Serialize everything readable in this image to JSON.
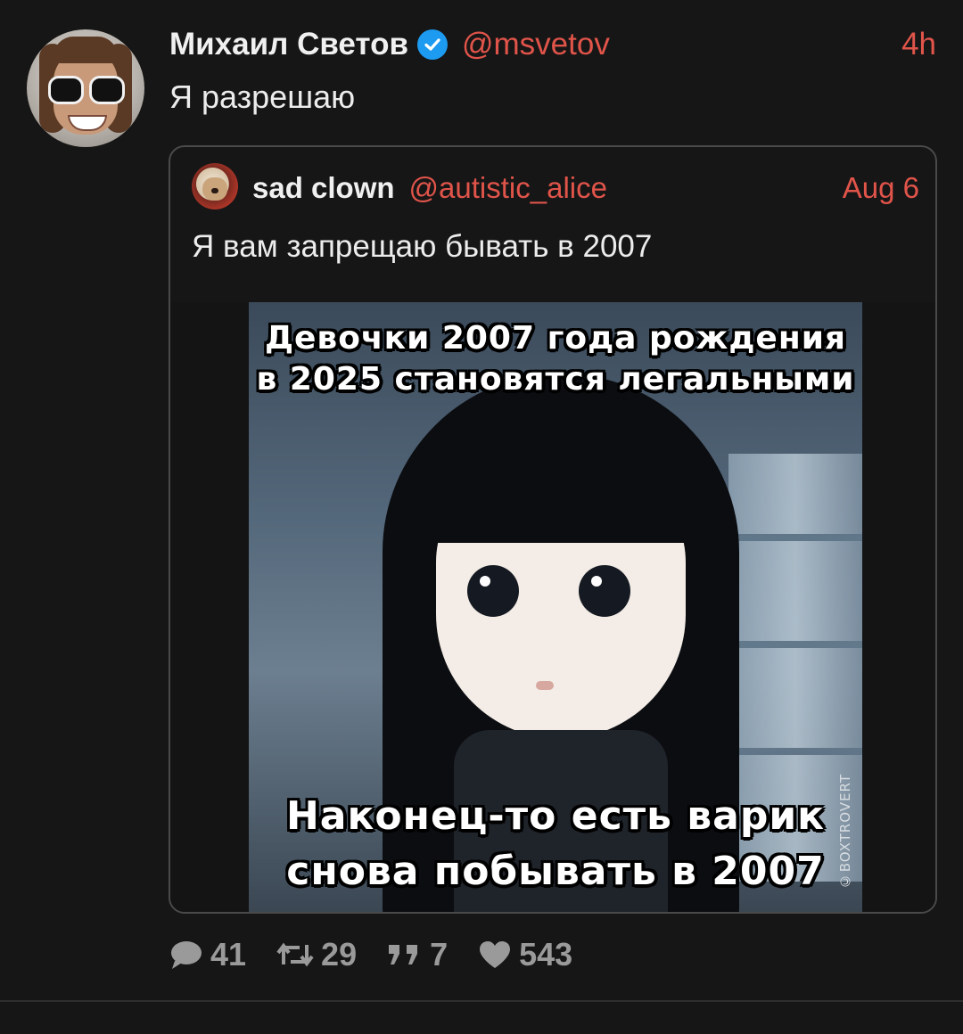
{
  "tweet": {
    "author_name": "Михаил Светов",
    "author_handle": "@msvetov",
    "time": "4h",
    "text": "Я разрешаю",
    "verified": true
  },
  "quoted_tweet": {
    "author_name": "sad clown",
    "author_handle": "@autistic_alice",
    "date": "Aug 6",
    "text": "Я вам запрещаю бывать в 2007",
    "media": {
      "caption_top": [
        "Девочки 2007 года рождения",
        "в 2025 становятся легальными"
      ],
      "caption_bottom": [
        "Наконец-то есть варик",
        "снова побывать в 2007"
      ],
      "credit": "©BOXTROVERT"
    }
  },
  "actions": {
    "replies": "41",
    "retweets": "29",
    "quotes": "7",
    "likes": "543"
  },
  "colors": {
    "background": "#161616",
    "accent": "#e0544a",
    "verified": "#1d9bf0",
    "muted": "#9a9a9a"
  },
  "icons": {
    "reply": "reply-icon",
    "retweet": "retweet-icon",
    "quote": "quote-icon",
    "like": "heart-icon",
    "verified": "verified-badge-icon"
  }
}
